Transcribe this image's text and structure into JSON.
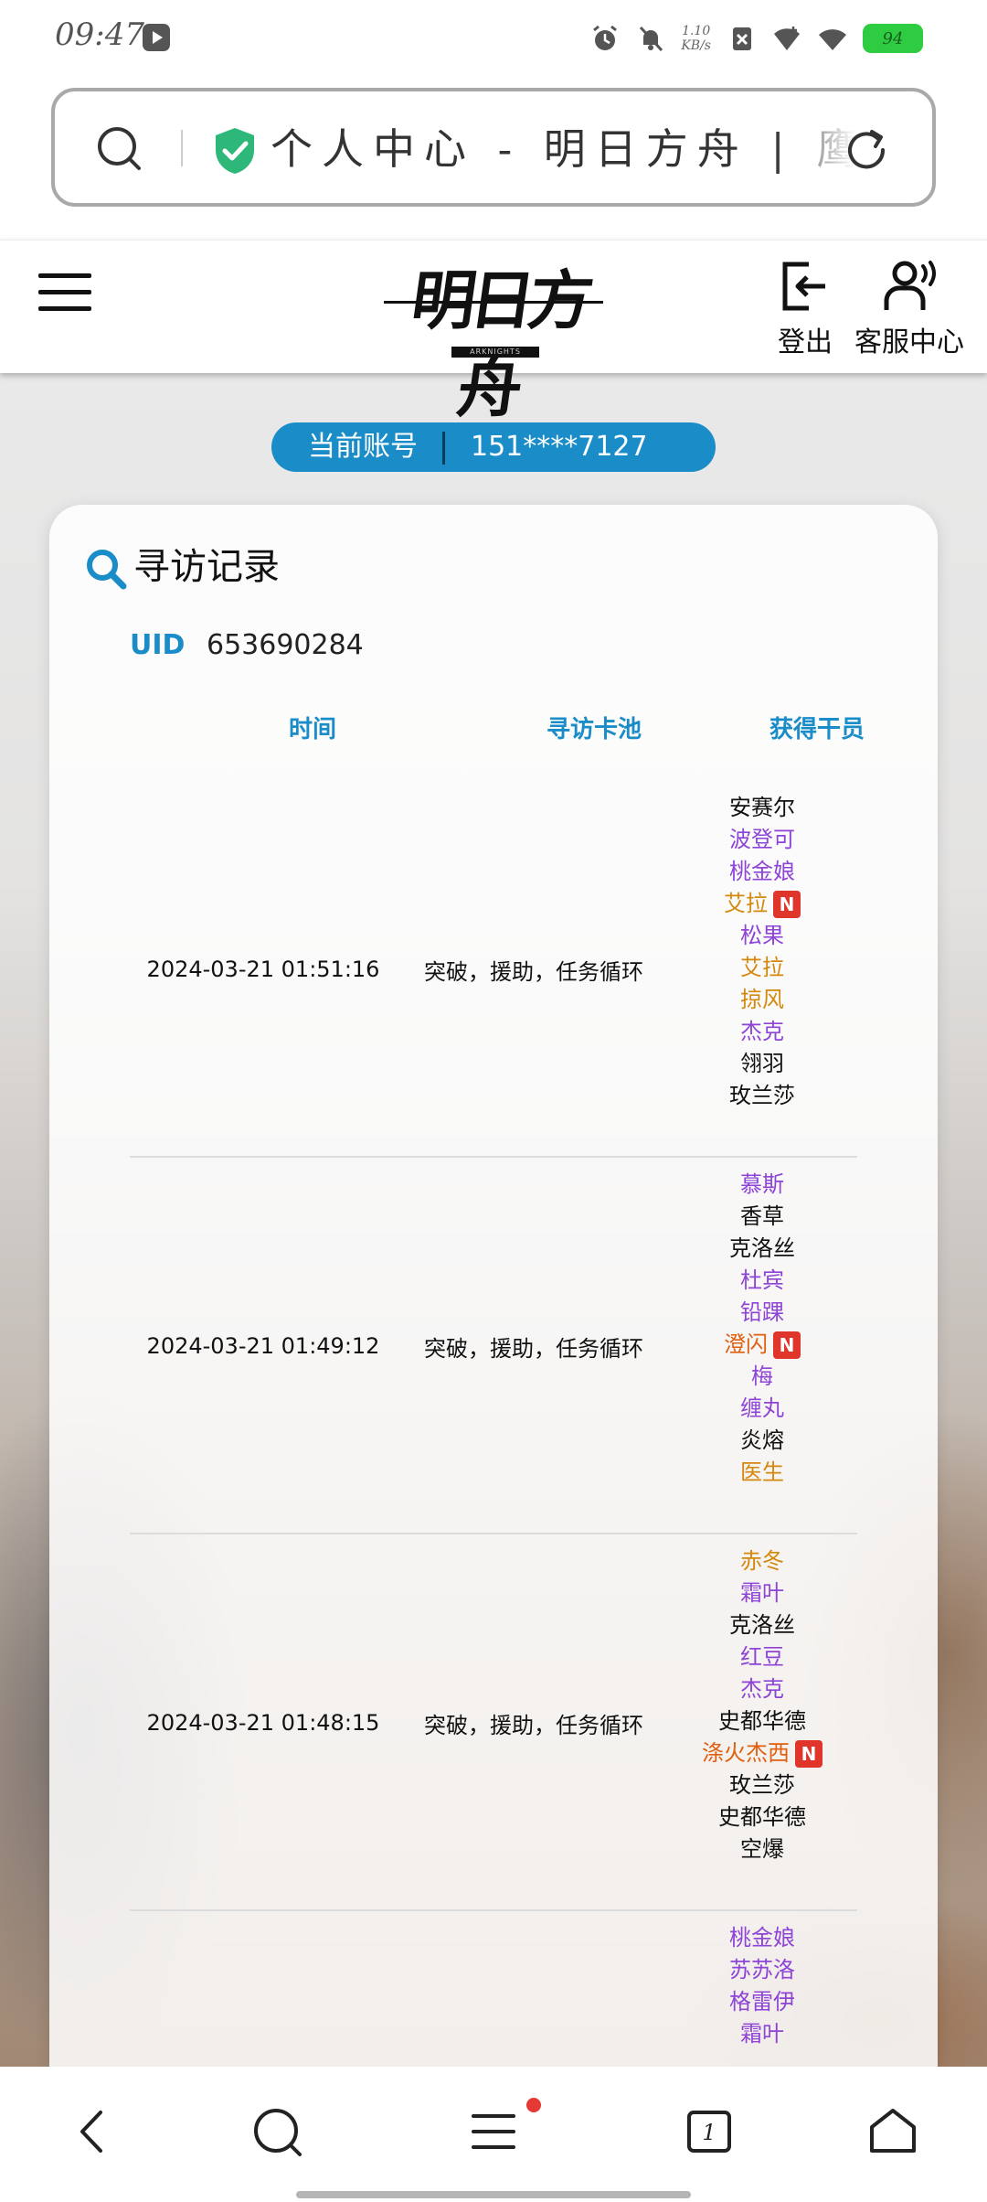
{
  "status_bar": {
    "time": "09:47",
    "net_speed_value": "1.10",
    "net_speed_unit": "KB/s",
    "battery": "94"
  },
  "url_bar": {
    "title": "个人中心 - 明日方舟 | 鹰角"
  },
  "header": {
    "logo_text": "明日方舟",
    "logo_sub": "ARKNIGHTS",
    "logout_label": "登出",
    "service_label": "客服中心"
  },
  "account": {
    "label": "当前账号",
    "value": "151****7127"
  },
  "card": {
    "title": "寻访记录",
    "uid_label": "UID",
    "uid_value": "653690284",
    "columns": [
      "时间",
      "寻访卡池",
      "获得干员"
    ]
  },
  "records": [
    {
      "time": "2024-03-21 01:51:16",
      "pool": "突破，援助，任务循环",
      "operators": [
        {
          "name": "安赛尔",
          "rarity": 3,
          "new": false
        },
        {
          "name": "波登可",
          "rarity": 4,
          "new": false
        },
        {
          "name": "桃金娘",
          "rarity": 4,
          "new": false
        },
        {
          "name": "艾拉",
          "rarity": 5,
          "new": true
        },
        {
          "name": "松果",
          "rarity": 4,
          "new": false
        },
        {
          "name": "艾拉",
          "rarity": 5,
          "new": false
        },
        {
          "name": "掠风",
          "rarity": 5,
          "new": false
        },
        {
          "name": "杰克",
          "rarity": 4,
          "new": false
        },
        {
          "name": "翎羽",
          "rarity": 3,
          "new": false
        },
        {
          "name": "玫兰莎",
          "rarity": 3,
          "new": false
        }
      ]
    },
    {
      "time": "2024-03-21 01:49:12",
      "pool": "突破，援助，任务循环",
      "operators": [
        {
          "name": "慕斯",
          "rarity": 4,
          "new": false
        },
        {
          "name": "香草",
          "rarity": 3,
          "new": false
        },
        {
          "name": "克洛丝",
          "rarity": 3,
          "new": false
        },
        {
          "name": "杜宾",
          "rarity": 4,
          "new": false
        },
        {
          "name": "铅踝",
          "rarity": 4,
          "new": false
        },
        {
          "name": "澄闪",
          "rarity": 6,
          "new": true
        },
        {
          "name": "梅",
          "rarity": 4,
          "new": false
        },
        {
          "name": "缠丸",
          "rarity": 4,
          "new": false
        },
        {
          "name": "炎熔",
          "rarity": 3,
          "new": false
        },
        {
          "name": "医生",
          "rarity": 5,
          "new": false
        }
      ]
    },
    {
      "time": "2024-03-21 01:48:15",
      "pool": "突破，援助，任务循环",
      "operators": [
        {
          "name": "赤冬",
          "rarity": 5,
          "new": false
        },
        {
          "name": "霜叶",
          "rarity": 4,
          "new": false
        },
        {
          "name": "克洛丝",
          "rarity": 3,
          "new": false
        },
        {
          "name": "红豆",
          "rarity": 4,
          "new": false
        },
        {
          "name": "杰克",
          "rarity": 4,
          "new": false
        },
        {
          "name": "史都华德",
          "rarity": 3,
          "new": false
        },
        {
          "name": "涤火杰西",
          "rarity": 6,
          "new": true
        },
        {
          "name": "玫兰莎",
          "rarity": 3,
          "new": false
        },
        {
          "name": "史都华德",
          "rarity": 3,
          "new": false
        },
        {
          "name": "空爆",
          "rarity": 3,
          "new": false
        }
      ]
    },
    {
      "time": "",
      "pool": "",
      "operators": [
        {
          "name": "桃金娘",
          "rarity": 4,
          "new": false
        },
        {
          "name": "苏苏洛",
          "rarity": 4,
          "new": false
        },
        {
          "name": "格雷伊",
          "rarity": 4,
          "new": false
        },
        {
          "name": "霜叶",
          "rarity": 4,
          "new": false
        }
      ]
    }
  ],
  "new_badge_label": "N",
  "bottom_nav": {
    "tab_count": "1"
  },
  "colors": {
    "accent": "#1a8cc8",
    "rarity_3": "#111111",
    "rarity_4": "#8e44d6",
    "rarity_5": "#d4880e",
    "rarity_6": "#e06010",
    "badge": "#e0352b"
  }
}
